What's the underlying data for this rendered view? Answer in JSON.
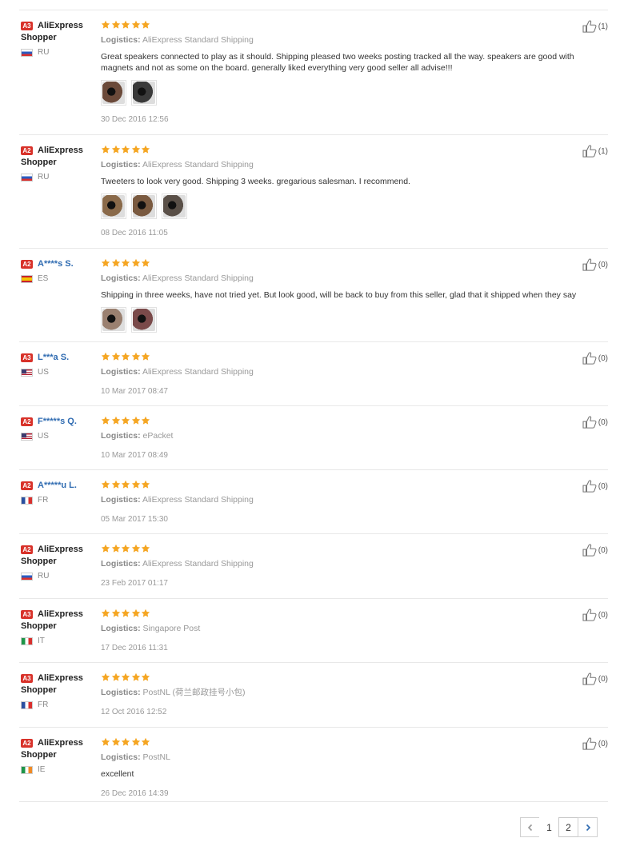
{
  "reviews": [
    {
      "badge": "A3",
      "name": "AliExpress",
      "name2": "Shopper",
      "blue": false,
      "flag": "ru",
      "country": "RU",
      "logistics_label": "Logistics:",
      "logistics": "AliExpress Standard Shipping",
      "text": "Great speakers connected to play as it should. Shipping pleased two weeks posting tracked all the way. speakers are good with magnets and not as some on the board. generally liked everything very good seller all advise!!!",
      "photos": 2,
      "date": "30 Dec 2016 12:56",
      "helpful": "(1)"
    },
    {
      "badge": "A2",
      "name": "AliExpress",
      "name2": "Shopper",
      "blue": false,
      "flag": "ru",
      "country": "RU",
      "logistics_label": "Logistics:",
      "logistics": "AliExpress Standard Shipping",
      "text": "Tweeters to look very good. Shipping 3 weeks. gregarious salesman. I recommend.",
      "photos": 3,
      "date": "08 Dec 2016 11:05",
      "helpful": "(1)"
    },
    {
      "badge": "A2",
      "name": "A****s S.",
      "name2": "",
      "blue": true,
      "flag": "es",
      "country": "ES",
      "logistics_label": "Logistics:",
      "logistics": "AliExpress Standard Shipping",
      "text": "Shipping in three weeks, have not tried yet. But look good, will be back to buy from this seller, glad that it shipped when they say",
      "photos": 2,
      "date": "",
      "helpful": "(0)"
    },
    {
      "badge": "A3",
      "name": "L***a S.",
      "name2": "",
      "blue": true,
      "flag": "us",
      "country": "US",
      "logistics_label": "Logistics:",
      "logistics": "AliExpress Standard Shipping",
      "text": "",
      "photos": 0,
      "date": "10 Mar 2017 08:47",
      "helpful": "(0)"
    },
    {
      "badge": "A2",
      "name": "F*****s Q.",
      "name2": "",
      "blue": true,
      "flag": "us",
      "country": "US",
      "logistics_label": "Logistics:",
      "logistics": "ePacket",
      "text": "",
      "photos": 0,
      "date": "10 Mar 2017 08:49",
      "helpful": "(0)"
    },
    {
      "badge": "A2",
      "name": "A*****u L.",
      "name2": "",
      "blue": true,
      "flag": "fr",
      "country": "FR",
      "logistics_label": "Logistics:",
      "logistics": "AliExpress Standard Shipping",
      "text": "",
      "photos": 0,
      "date": "05 Mar 2017 15:30",
      "helpful": "(0)"
    },
    {
      "badge": "A2",
      "name": "AliExpress",
      "name2": "Shopper",
      "blue": false,
      "flag": "ru",
      "country": "RU",
      "logistics_label": "Logistics:",
      "logistics": "AliExpress Standard Shipping",
      "text": "",
      "photos": 0,
      "date": "23 Feb 2017 01:17",
      "helpful": "(0)"
    },
    {
      "badge": "A3",
      "name": "AliExpress",
      "name2": "Shopper",
      "blue": false,
      "flag": "it",
      "country": "IT",
      "logistics_label": "Logistics:",
      "logistics": "Singapore Post",
      "text": "",
      "photos": 0,
      "date": "17 Dec 2016 11:31",
      "helpful": "(0)"
    },
    {
      "badge": "A3",
      "name": "AliExpress",
      "name2": "Shopper",
      "blue": false,
      "flag": "fr",
      "country": "FR",
      "logistics_label": "Logistics:",
      "logistics": "PostNL (荷兰邮政挂号小包)",
      "text": "",
      "photos": 0,
      "date": "12 Oct 2016 12:52",
      "helpful": "(0)"
    },
    {
      "badge": "A2",
      "name": "AliExpress",
      "name2": "Shopper",
      "blue": false,
      "flag": "ie",
      "country": "IE",
      "logistics_label": "Logistics:",
      "logistics": "PostNL",
      "text": "excellent",
      "photos": 0,
      "date": "26 Dec 2016 14:39",
      "helpful": "(0)"
    }
  ],
  "rating_stars": 5,
  "colors": {
    "star": "#f5a623",
    "badge": "#d8322a",
    "name_blue": "#2f6bb1"
  },
  "pagination": {
    "prev_icon": "chevron-left-icon",
    "pages": [
      "1",
      "2"
    ],
    "current": "2",
    "next_icon": "chevron-right-icon"
  }
}
